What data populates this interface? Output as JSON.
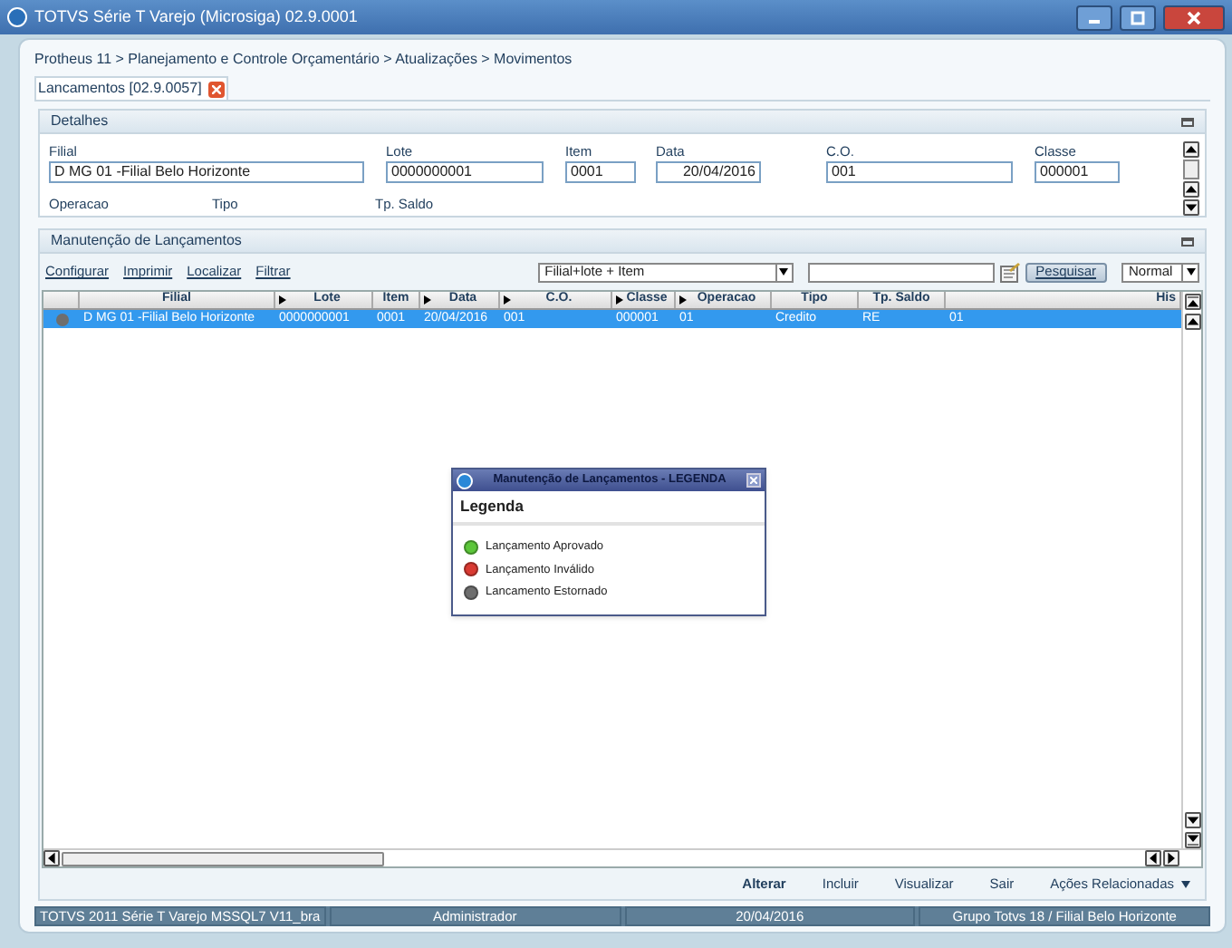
{
  "window": {
    "title": "TOTVS Série T Varejo (Microsiga) 02.9.0001"
  },
  "breadcrumb": "Protheus 11 > Planejamento e Controle Orçamentário > Atualizações > Movimentos",
  "tab": {
    "label": "Lancamentos [02.9.0057]",
    "selected": true
  },
  "details": {
    "title": "Detalhes",
    "fields": [
      {
        "label": "Filial",
        "value": "D MG 01 -Filial Belo Horizonte"
      },
      {
        "label": "Lote",
        "value": "0000000001"
      },
      {
        "label": "Item",
        "value": "0001"
      },
      {
        "label": "Data",
        "value": "20/04/2016",
        "kind": "date"
      },
      {
        "label": "C.O.",
        "value": "001"
      },
      {
        "label": "Classe",
        "value": "000001"
      }
    ],
    "more_labels": [
      "Operacao",
      "Tipo",
      "Tp. Saldo"
    ]
  },
  "maintenance": {
    "title": "Manutenção de Lançamentos",
    "links": [
      "Configurar",
      "Imprimir",
      "Localizar",
      "Filtrar"
    ],
    "index_combo": "Filial+lote + Item",
    "search_button": "Pesquisar",
    "view_combo": "Normal",
    "columns": [
      {
        "label": "Filial",
        "arrow": false
      },
      {
        "label": "Lote",
        "arrow": true
      },
      {
        "label": "Item",
        "arrow": false
      },
      {
        "label": "Data",
        "arrow": true
      },
      {
        "label": "C.O.",
        "arrow": true
      },
      {
        "label": "Classe",
        "arrow": true
      },
      {
        "label": "Operacao",
        "arrow": true
      },
      {
        "label": "Tipo",
        "arrow": false
      },
      {
        "label": "Tp. Saldo",
        "arrow": false
      },
      {
        "label": "His",
        "arrow": false
      }
    ],
    "rows": [
      {
        "selected": true,
        "color": "#6e6e6e",
        "cells": [
          "D MG 01 -Filial Belo Horizonte",
          "0000000001",
          "0001",
          "20/04/2016",
          "001",
          "000001",
          "01",
          "Credito",
          "RE",
          "01"
        ]
      }
    ],
    "actions": [
      {
        "label": "Alterar",
        "bold": true
      },
      {
        "label": "Incluir",
        "bold": false
      },
      {
        "label": "Visualizar",
        "bold": false
      },
      {
        "label": "Sair",
        "bold": false
      },
      {
        "label": "Ações Relacionadas",
        "bold": false
      }
    ]
  },
  "legend": {
    "title": "Manutenção de Lançamentos - LEGENDA",
    "heading": "Legenda",
    "items": [
      {
        "label": "Lançamento Aprovado",
        "color": "#5cc63a"
      },
      {
        "label": "Lançamento Inválido",
        "color": "#d93a32"
      },
      {
        "label": "Lancamento Estornado",
        "color": "#6e6e6e"
      }
    ]
  },
  "status_bar": [
    "TOTVS 2011 Série T Varejo MSSQL7 V11_bra",
    "Administrador",
    "20/04/2016",
    "Grupo Totvs 18 / Filial Belo Horizonte"
  ]
}
